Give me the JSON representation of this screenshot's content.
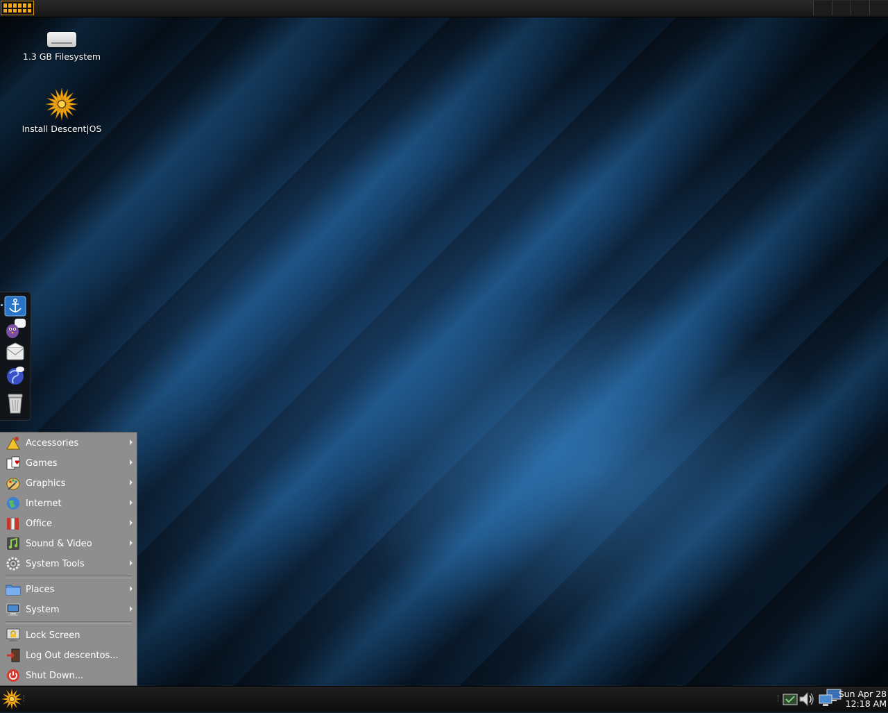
{
  "desktop": {
    "icons": [
      {
        "label": "1.3 GB Filesystem",
        "icon": "drive-icon"
      },
      {
        "label": "Install Descent|OS",
        "icon": "descentos-logo-icon"
      }
    ]
  },
  "dock": {
    "items": [
      {
        "icon": "anchor-icon"
      },
      {
        "icon": "pidgin-chat-icon"
      },
      {
        "icon": "mail-icon"
      },
      {
        "icon": "web-browser-icon"
      },
      {
        "icon": "trash-icon"
      }
    ]
  },
  "menu": {
    "applications": [
      {
        "label": "Accessories",
        "icon": "accessories-icon"
      },
      {
        "label": "Games",
        "icon": "games-icon"
      },
      {
        "label": "Graphics",
        "icon": "graphics-icon"
      },
      {
        "label": "Internet",
        "icon": "internet-globe-icon"
      },
      {
        "label": "Office",
        "icon": "office-icon"
      },
      {
        "label": "Sound & Video",
        "icon": "sound-video-icon"
      },
      {
        "label": "System Tools",
        "icon": "gear-icon"
      }
    ],
    "places": [
      {
        "label": "Places",
        "icon": "folder-icon"
      },
      {
        "label": "System",
        "icon": "computer-icon"
      }
    ],
    "session": [
      {
        "label": "Lock Screen",
        "icon": "lock-icon"
      },
      {
        "label": "Log Out descentos...",
        "icon": "logout-icon"
      },
      {
        "label": "Shut Down...",
        "icon": "power-icon"
      }
    ]
  },
  "tray": {
    "icons": [
      "update-notifier-icon",
      "volume-icon",
      "network-icon"
    ],
    "clock": {
      "date": "Sun Apr 28",
      "time": "12:18 AM"
    }
  },
  "colors": {
    "accent": "#f2a81a",
    "menu_bg": "#8e8e8e",
    "panel_bg": "#161616"
  }
}
